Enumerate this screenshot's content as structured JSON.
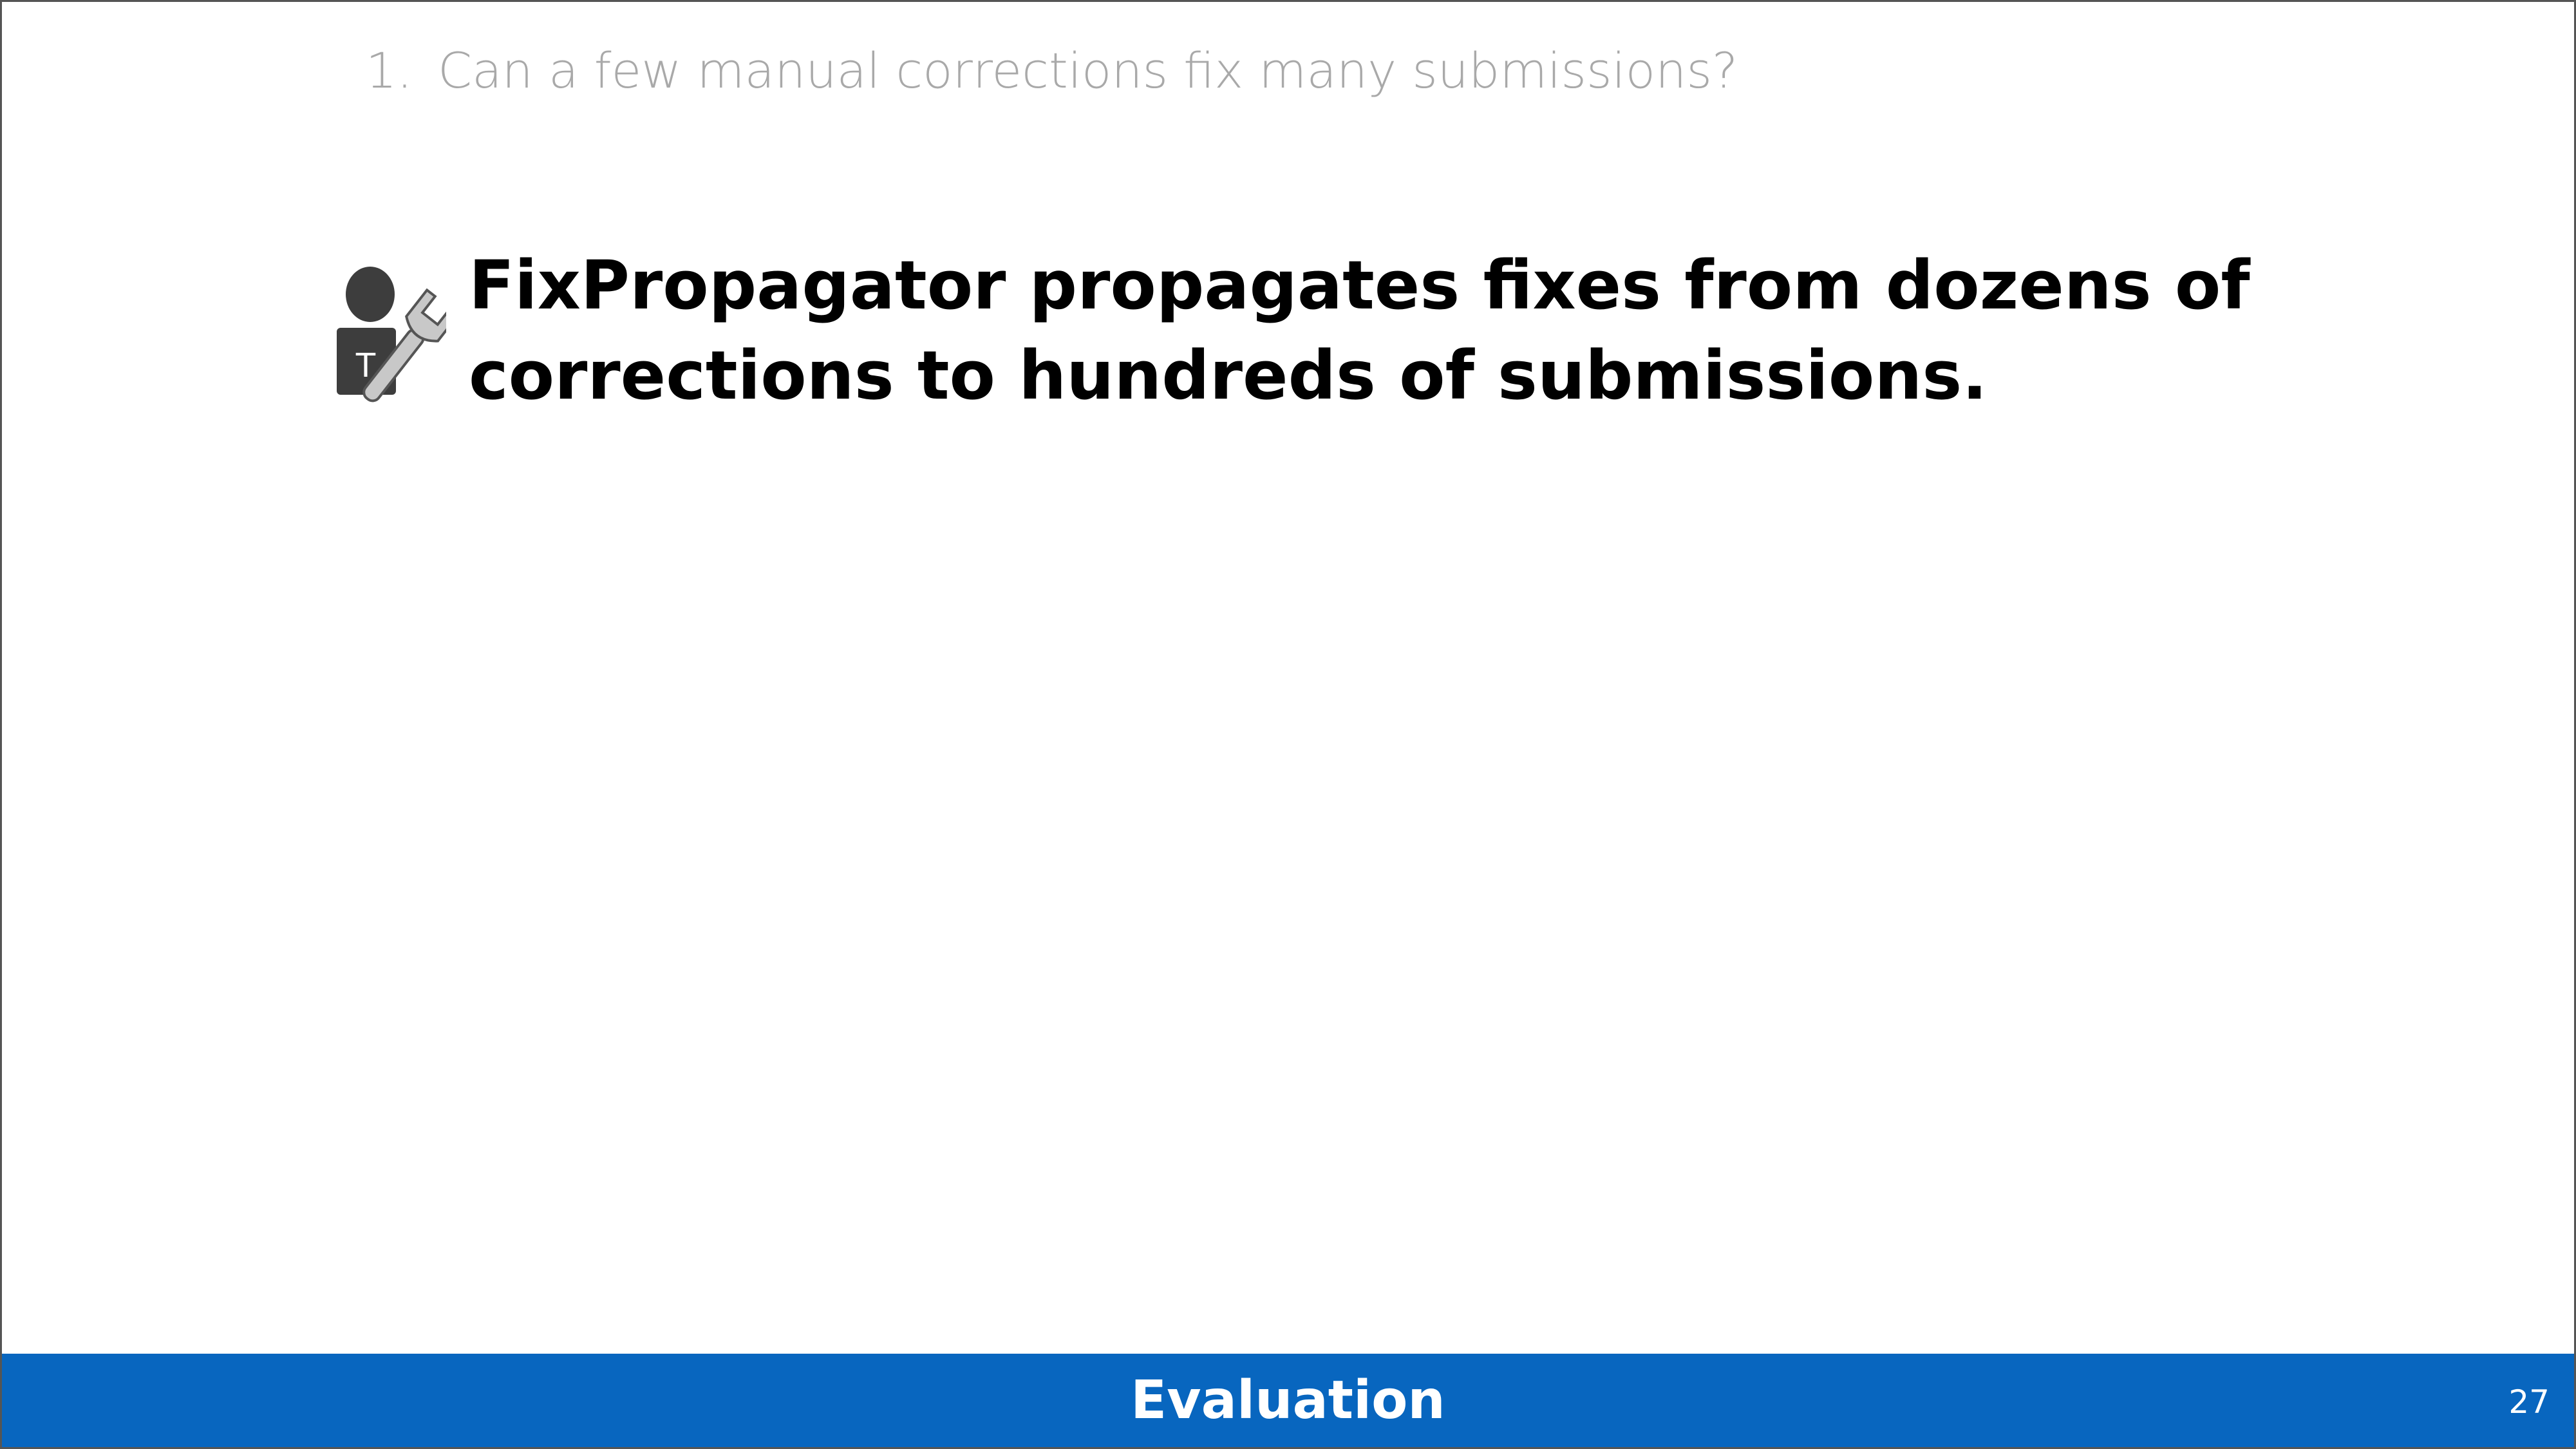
{
  "question": {
    "number": "1.",
    "text": "Can a few manual corrections fix many submissions?"
  },
  "claim": {
    "icon": "teacher-wrench-icon",
    "line1": "FixPropagator propagates fixes from dozens of",
    "line2": "corrections to hundreds of submissions.",
    "icon_letter": "T"
  },
  "footer": {
    "title": "Evaluation",
    "page_number": "27",
    "color": "#0866bf"
  }
}
